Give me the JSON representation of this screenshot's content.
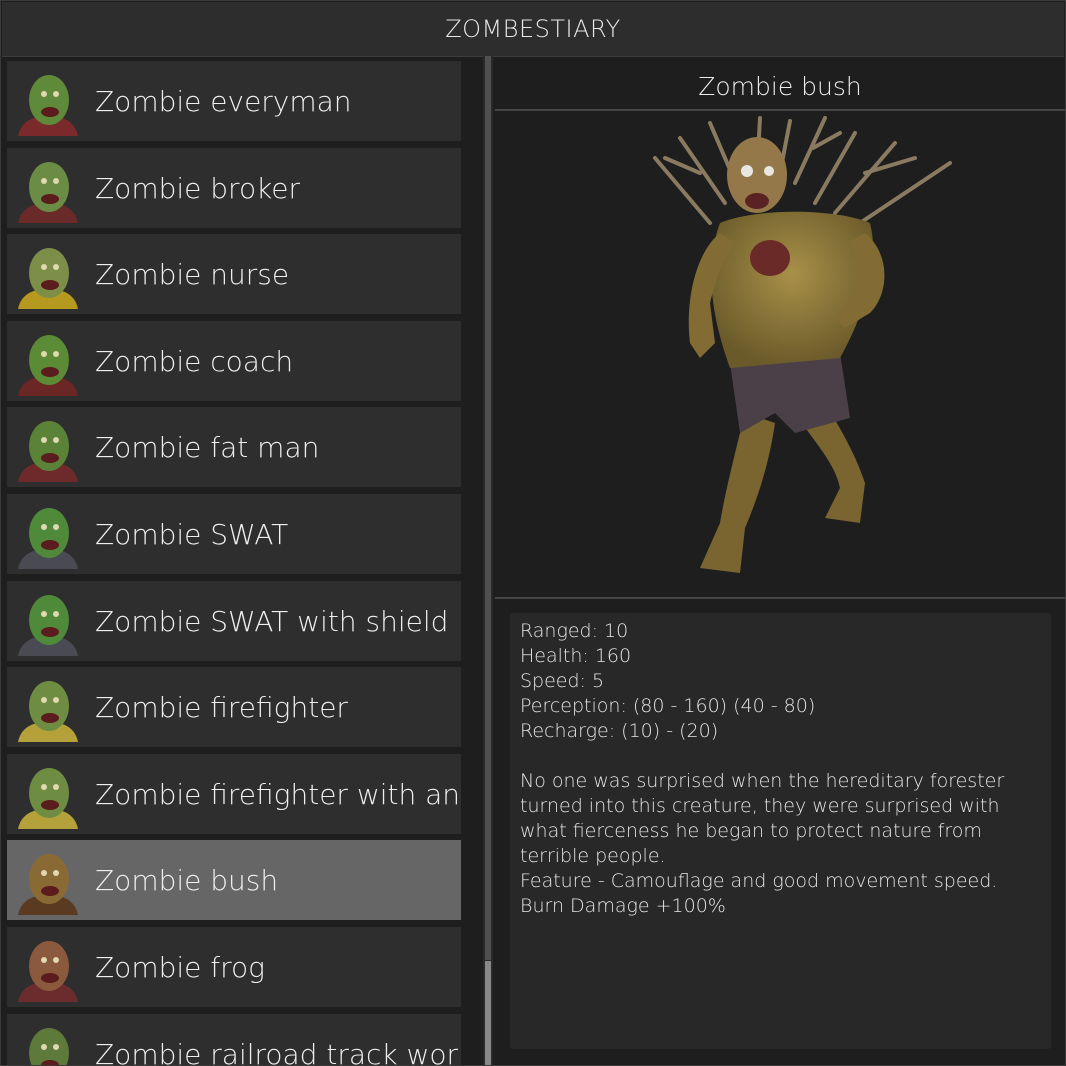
{
  "window": {
    "title": "ZOMBESTIARY"
  },
  "list": {
    "items": [
      {
        "label": "Zombie everyman",
        "icon": "zombie-everyman-portrait-icon",
        "skin": "#5f8a3a",
        "accent": "#7a2a2a",
        "selected": false
      },
      {
        "label": "Zombie broker",
        "icon": "zombie-broker-portrait-icon",
        "skin": "#6a8c44",
        "accent": "#6b2a2a",
        "selected": false
      },
      {
        "label": "Zombie nurse",
        "icon": "zombie-nurse-portrait-icon",
        "skin": "#7d8e49",
        "accent": "#b59a1f",
        "selected": false
      },
      {
        "label": "Zombie coach",
        "icon": "zombie-coach-portrait-icon",
        "skin": "#5c8b36",
        "accent": "#6b2626",
        "selected": false
      },
      {
        "label": "Zombie fat man",
        "icon": "zombie-fat-man-portrait-icon",
        "skin": "#5a8338",
        "accent": "#6e2a2a",
        "selected": false
      },
      {
        "label": "Zombie SWAT",
        "icon": "zombie-swat-portrait-icon",
        "skin": "#4f8a3a",
        "accent": "#4a4a52",
        "selected": false
      },
      {
        "label": "Zombie SWAT with shield",
        "icon": "zombie-swat-shield-portrait-icon",
        "skin": "#4f8a3a",
        "accent": "#4a4a52",
        "selected": false
      },
      {
        "label": "Zombie firefighter",
        "icon": "zombie-firefighter-portrait-icon",
        "skin": "#6f8d42",
        "accent": "#b5a13a",
        "selected": false
      },
      {
        "label": "Zombie firefighter with an ax",
        "icon": "zombie-firefighter-ax-portrait-icon",
        "skin": "#6f8d42",
        "accent": "#b5a13a",
        "selected": false
      },
      {
        "label": "Zombie bush",
        "icon": "zombie-bush-portrait-icon",
        "skin": "#8a6a34",
        "accent": "#5b3a22",
        "selected": true
      },
      {
        "label": "Zombie frog",
        "icon": "zombie-frog-portrait-icon",
        "skin": "#8b5a3e",
        "accent": "#6a2c2c",
        "selected": false
      },
      {
        "label": "Zombie railroad track worker",
        "icon": "zombie-railroad-worker-portrait-icon",
        "skin": "#5d7a3a",
        "accent": "#3c4a2c",
        "selected": false
      }
    ]
  },
  "detail": {
    "name": "Zombie bush",
    "stats": [
      "Ranged: 10",
      "Health: 160",
      "Speed: 5",
      "Perception: (80 - 160) (40 - 80)",
      "Recharge: (10) - (20)"
    ],
    "description": [
      "No one was surprised when the hereditary forester",
      "turned into this creature, they were surprised with",
      "what fierceness he began to protect nature from",
      "terrible people.",
      "Feature - Camouflage and good movement speed.",
      "Burn Damage +100%"
    ]
  },
  "colors": {
    "selected_row": "#666666",
    "row": "#2e2e2e",
    "header": "#2d2d2d",
    "creature_skin": "#8d7a3c"
  }
}
